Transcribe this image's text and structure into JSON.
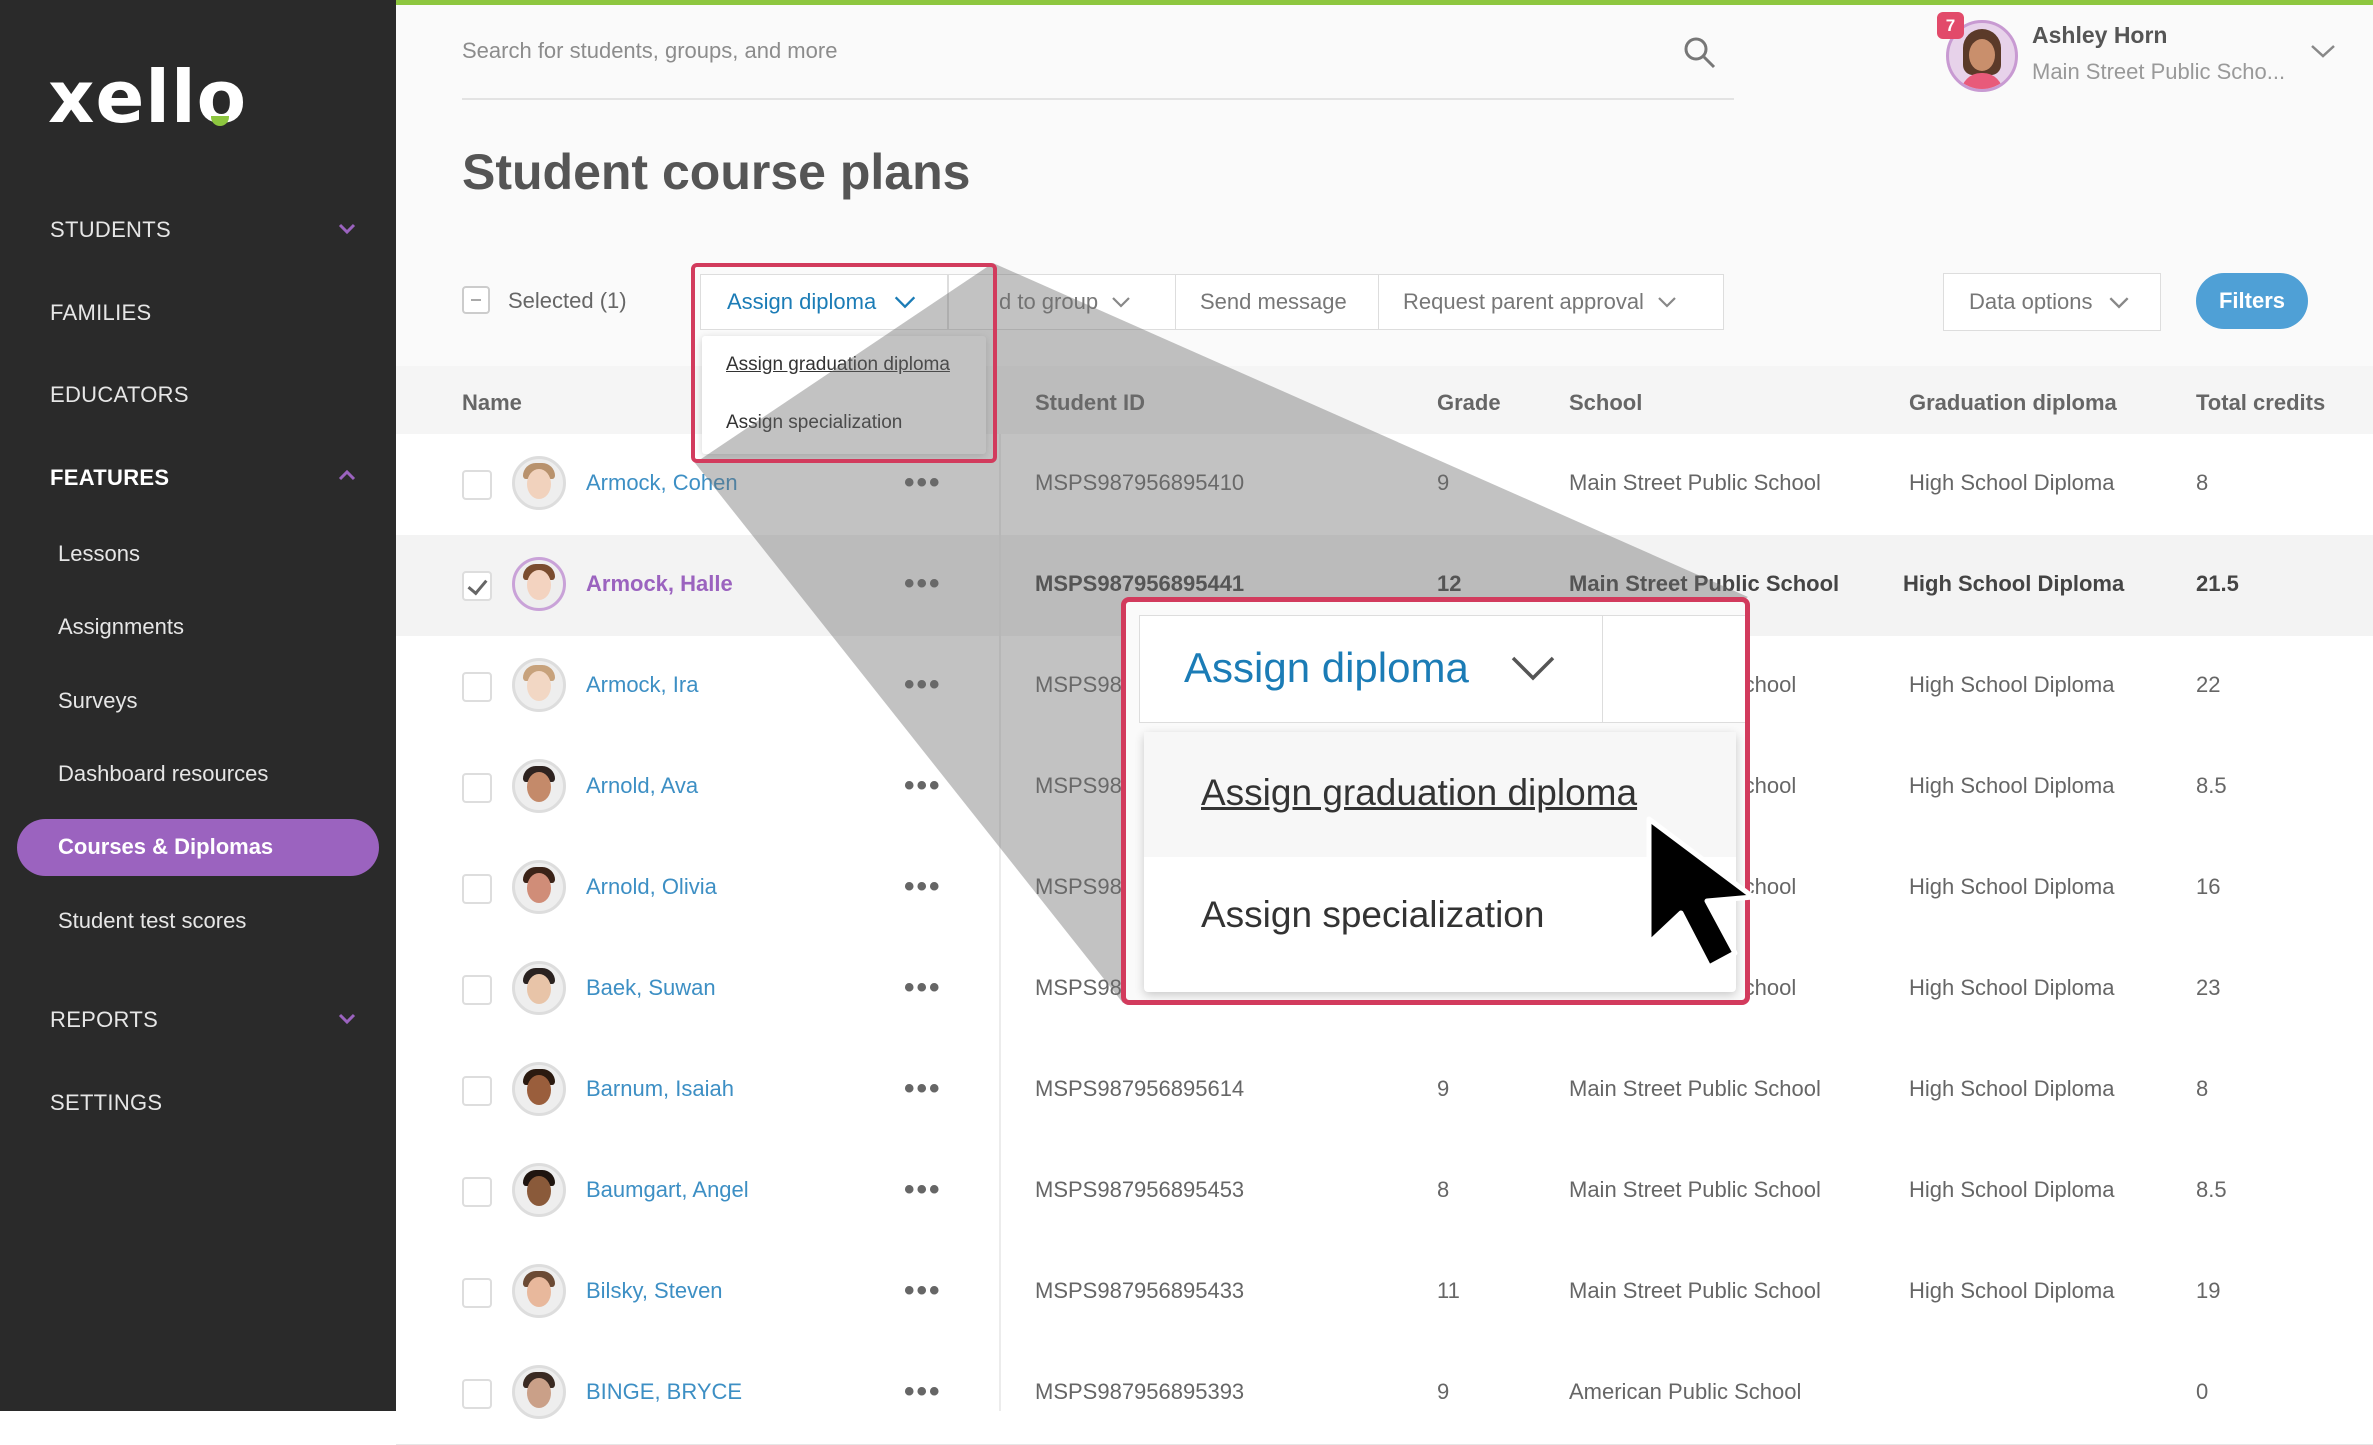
{
  "app": {
    "logo": "xello"
  },
  "sidebar": {
    "sections": [
      {
        "label": "STUDENTS"
      },
      {
        "label": "FAMILIES"
      },
      {
        "label": "EDUCATORS"
      },
      {
        "label": "FEATURES"
      },
      {
        "label": "REPORTS"
      },
      {
        "label": "SETTINGS"
      }
    ],
    "items": [
      "Lessons",
      "Assignments",
      "Surveys",
      "Dashboard resources",
      "Courses & Diplomas",
      "Student test scores"
    ]
  },
  "header": {
    "search_placeholder": "Search for students, groups, and more",
    "user_name": "Ashley Horn",
    "user_school": "Main Street Public Scho...",
    "notification_count": "7"
  },
  "page": {
    "title": "Student course plans"
  },
  "toolbar": {
    "selected_label": "Selected (1)",
    "assign_diploma": "Assign diploma",
    "add_to_group": "d to group",
    "send_message": "Send message",
    "request_parent_approval": "Request parent approval",
    "data_options": "Data options",
    "filters": "Filters"
  },
  "dropdown": {
    "option1": "Assign graduation diploma",
    "option2": "Assign specialization"
  },
  "table": {
    "headers": [
      "Name",
      "Student ID",
      "Grade",
      "School",
      "Graduation diploma",
      "Total credits"
    ],
    "rows": [
      {
        "name": "Armock, Cohen",
        "id": "MSPS987956895410",
        "grade": "9",
        "school": "Main Street Public School",
        "diploma": "High School Diploma",
        "credits": "8"
      },
      {
        "name": "Armock, Halle",
        "id": "MSPS987956895441",
        "grade": "12",
        "school": "Main Street Public School",
        "diploma": "High School Diploma",
        "credits": "21.5"
      },
      {
        "name": "Armock, Ira",
        "id": "MSPS98",
        "grade": "",
        "school": "School",
        "diploma": "High School Diploma",
        "credits": "22"
      },
      {
        "name": "Arnold, Ava",
        "id": "MSPS98",
        "grade": "",
        "school": "School",
        "diploma": "High School Diploma",
        "credits": "8.5"
      },
      {
        "name": "Arnold, Olivia",
        "id": "MSPS98",
        "grade": "",
        "school": "School",
        "diploma": "High School Diploma",
        "credits": "16"
      },
      {
        "name": "Baek, Suwan",
        "id": "MSPS98",
        "grade": "",
        "school": "School",
        "diploma": "High School Diploma",
        "credits": "23"
      },
      {
        "name": "Barnum, Isaiah",
        "id": "MSPS987956895614",
        "grade": "9",
        "school": "Main Street Public School",
        "diploma": "High School Diploma",
        "credits": "8"
      },
      {
        "name": "Baumgart, Angel",
        "id": "MSPS987956895453",
        "grade": "8",
        "school": "Main Street Public School",
        "diploma": "High School Diploma",
        "credits": "8.5"
      },
      {
        "name": "Bilsky, Steven",
        "id": "MSPS987956895433",
        "grade": "11",
        "school": "Main Street Public School",
        "diploma": "High School Diploma",
        "credits": "19"
      },
      {
        "name": "BINGE, BRYCE",
        "id": "MSPS987956895393",
        "grade": "9",
        "school": "American Public School",
        "diploma": "",
        "credits": "0"
      }
    ]
  },
  "colors": {
    "accent": "#9b63bf",
    "link": "#3d8fc4",
    "highlight": "#d23b5d",
    "brand_green": "#8dc63f"
  }
}
